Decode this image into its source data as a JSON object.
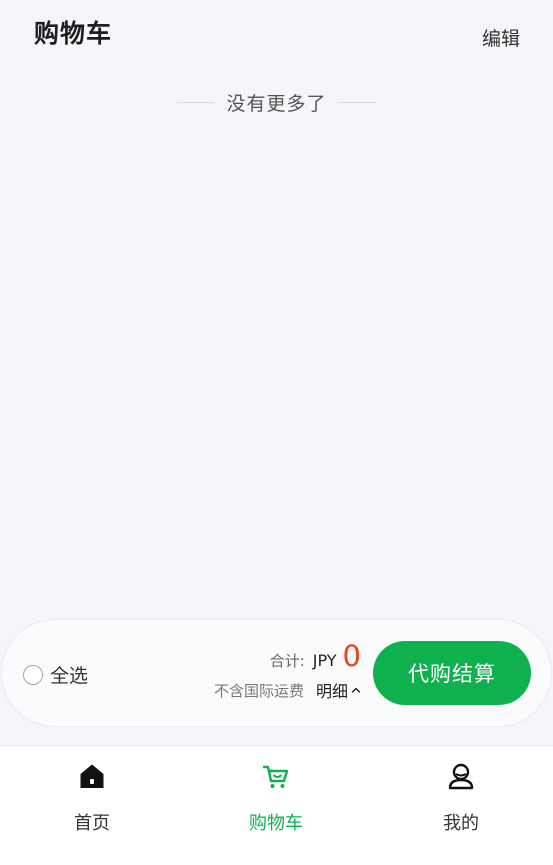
{
  "header": {
    "title": "购物车",
    "edit_label": "编辑"
  },
  "list": {
    "no_more_text": "没有更多了"
  },
  "checkout": {
    "select_all_label": "全选",
    "total_label": "合计:",
    "currency": "JPY",
    "amount": "0",
    "fee_note": "不含国际运费",
    "detail_label": "明细",
    "checkout_label": "代购结算"
  },
  "tabbar": {
    "items": [
      {
        "label": "首页",
        "icon": "home-icon",
        "active": false
      },
      {
        "label": "购物车",
        "icon": "cart-icon",
        "active": true
      },
      {
        "label": "我的",
        "icon": "user-icon",
        "active": false
      }
    ]
  },
  "colors": {
    "accent": "#0fb14f",
    "price": "#f0401a",
    "background": "#f5f6f9"
  }
}
